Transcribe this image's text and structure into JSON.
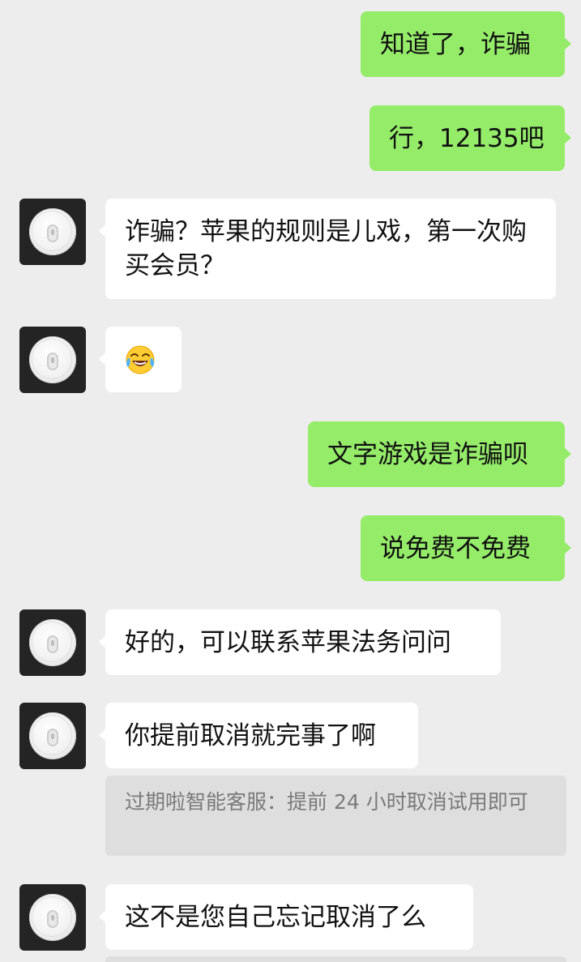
{
  "messages": [
    {
      "id": "m1",
      "side": "out",
      "text": "知道了，诈骗"
    },
    {
      "id": "m2",
      "side": "out",
      "text": "行，12135吧"
    },
    {
      "id": "m3",
      "side": "in",
      "text": "诈骗？苹果的规则是儿戏，第一次购买会员？"
    },
    {
      "id": "m4",
      "side": "in",
      "emoji": "face-with-tears-of-joy"
    },
    {
      "id": "m5",
      "side": "out",
      "text": "文字游戏是诈骗呗"
    },
    {
      "id": "m6",
      "side": "out",
      "text": "说免费不免费"
    },
    {
      "id": "m7",
      "side": "in",
      "text": "好的，可以联系苹果法务问问"
    },
    {
      "id": "m8",
      "side": "in",
      "text": "你提前取消就完事了啊",
      "quote": "过期啦智能客服：提前 24 小时取消试用即可"
    },
    {
      "id": "m9",
      "side": "in",
      "text": "这不是您自己忘记取消了么"
    }
  ],
  "colors": {
    "background": "#ededed",
    "outgoing_bubble": "#95ec69",
    "incoming_bubble": "#ffffff",
    "quote_bubble": "#dedede",
    "avatar_bg": "#242424"
  }
}
